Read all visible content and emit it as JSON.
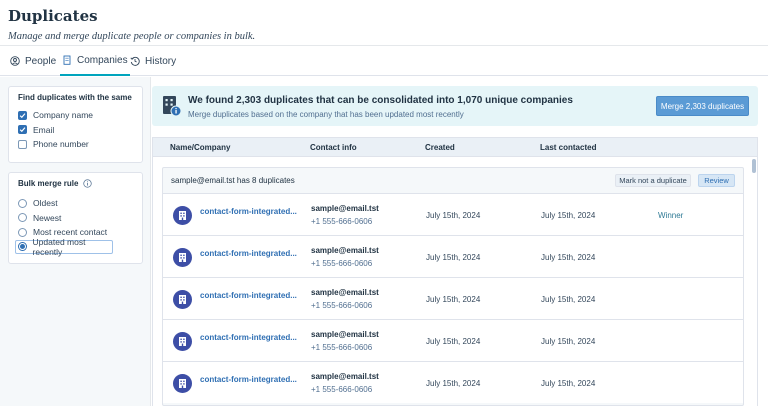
{
  "header": {
    "title": "Duplicates",
    "subtitle": "Manage and merge duplicate people or companies in bulk."
  },
  "tabs": [
    {
      "label": "People",
      "icon": "person-icon",
      "active": false
    },
    {
      "label": "Companies",
      "icon": "building-icon",
      "active": true
    },
    {
      "label": "History",
      "icon": "history-icon",
      "active": false
    }
  ],
  "filters": {
    "title": "Find duplicates with the same",
    "options": [
      {
        "label": "Company name",
        "checked": true
      },
      {
        "label": "Email",
        "checked": true
      },
      {
        "label": "Phone number",
        "checked": false
      }
    ]
  },
  "merge_rule": {
    "title": "Bulk merge rule",
    "info_icon": "info-icon",
    "options": [
      {
        "label": "Oldest",
        "selected": false
      },
      {
        "label": "Newest",
        "selected": false
      },
      {
        "label": "Most recent contact",
        "selected": false
      },
      {
        "label": "Updated most recently",
        "selected": true
      }
    ]
  },
  "banner": {
    "title": "We found 2,303 duplicates that can be consolidated into 1,070 unique companies",
    "subtitle": "Merge duplicates based on the company that has been updated most recently",
    "button": "Merge 2,303 duplicates"
  },
  "table": {
    "columns": [
      "Name/Company",
      "Contact info",
      "Created",
      "Last contacted"
    ],
    "group": {
      "title": "sample@email.tst has 8 duplicates",
      "not_duplicate_label": "Mark not a duplicate",
      "review_label": "Review"
    },
    "rows": [
      {
        "name": "contact-form-integrated...",
        "email": "sample@email.tst",
        "phone": "+1 555-666-0606",
        "created": "July 15th, 2024",
        "last_contacted": "July 15th, 2024",
        "badge": "Winner"
      },
      {
        "name": "contact-form-integrated...",
        "email": "sample@email.tst",
        "phone": "+1 555-666-0606",
        "created": "July 15th, 2024",
        "last_contacted": "July 15th, 2024",
        "badge": ""
      },
      {
        "name": "contact-form-integrated...",
        "email": "sample@email.tst",
        "phone": "+1 555-666-0606",
        "created": "July 15th, 2024",
        "last_contacted": "July 15th, 2024",
        "badge": ""
      },
      {
        "name": "contact-form-integrated...",
        "email": "sample@email.tst",
        "phone": "+1 555-666-0606",
        "created": "July 15th, 2024",
        "last_contacted": "July 15th, 2024",
        "badge": ""
      },
      {
        "name": "contact-form-integrated...",
        "email": "sample@email.tst",
        "phone": "+1 555-666-0606",
        "created": "July 15th, 2024",
        "last_contacted": "July 15th, 2024",
        "badge": ""
      }
    ]
  },
  "colors": {
    "accent": "#2f6fb3",
    "banner_bg": "#e5f5f8",
    "tab_underline": "#00a4bd",
    "company_icon": "#3d4ea6"
  }
}
